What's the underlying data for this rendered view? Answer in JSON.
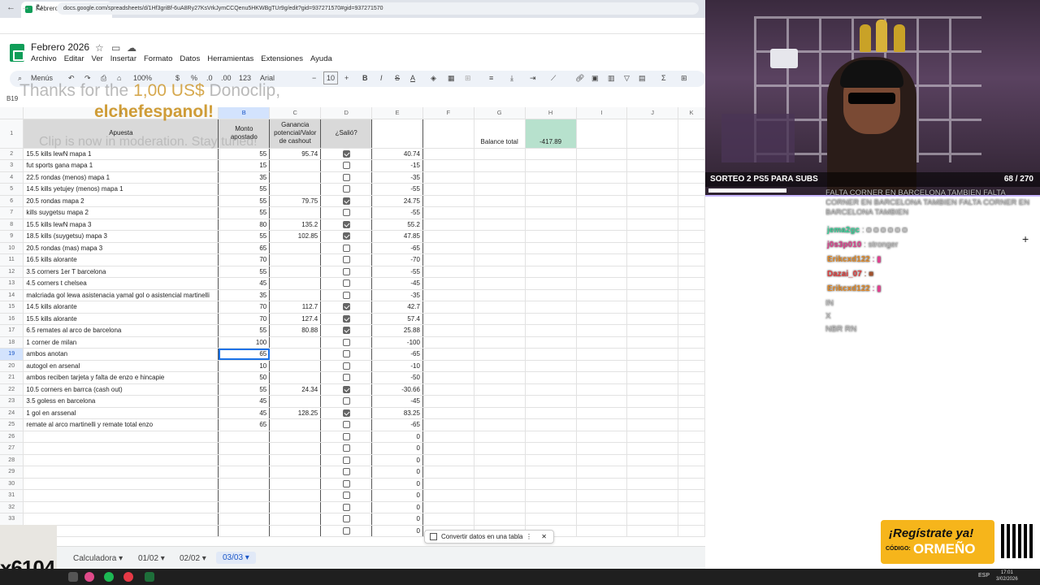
{
  "browser": {
    "tab_title": "Febrero 2026 - Hojas de cálcul",
    "tab_close": "×",
    "new_tab": "+",
    "url": "docs.google.com/spreadsheets/d/1Hf3griBf-6uA8Ry27KsVrkJymCCQenu5HKWBgTUr9g/edit?gid=937271570#gid=937271570"
  },
  "sheets": {
    "doc_title": "Febrero 2026",
    "menu": [
      "Archivo",
      "Editar",
      "Ver",
      "Insertar",
      "Formato",
      "Datos",
      "Herramientas",
      "Extensiones",
      "Ayuda"
    ],
    "toolbar": {
      "menus": "Menús",
      "zoom": "100%",
      "currency": "$",
      "percent": "%",
      "dec_less": ".0",
      "dec_more": ".00",
      "format_123": "123",
      "font": "Arial",
      "font_size": "10",
      "bold": "B",
      "italic": "I",
      "text_color": "A"
    },
    "name_box": "B19",
    "columns": [
      "A",
      "B",
      "C",
      "D",
      "E",
      "F",
      "G",
      "H",
      "I",
      "J",
      "K"
    ],
    "header_row": {
      "a": "Apuesta",
      "b": "Monto apostado",
      "c": "Ganancia potencial/Valor de cashout",
      "d": "¿Salió?",
      "g": "Balance total",
      "h": "-417.89"
    },
    "rows": [
      {
        "n": "2",
        "a": "15.5 kills lewN mapa 1",
        "b": "55",
        "c": "95.74",
        "d": true,
        "e": "40.74"
      },
      {
        "n": "3",
        "a": "fut sports gana mapa 1",
        "b": "15",
        "c": "",
        "d": false,
        "e": "-15"
      },
      {
        "n": "4",
        "a": "22.5 rondas (menos) mapa 1",
        "b": "35",
        "c": "",
        "d": false,
        "e": "-35"
      },
      {
        "n": "5",
        "a": "14.5 kills yetujey (menos) mapa 1",
        "b": "55",
        "c": "",
        "d": false,
        "e": "-55"
      },
      {
        "n": "6",
        "a": "20.5 rondas mapa 2",
        "b": "55",
        "c": "79.75",
        "d": true,
        "e": "24.75"
      },
      {
        "n": "7",
        "a": "kills suygetsu mapa 2",
        "b": "55",
        "c": "",
        "d": false,
        "e": "-55"
      },
      {
        "n": "8",
        "a": "15.5 kills lewN mapa 3",
        "b": "80",
        "c": "135.2",
        "d": true,
        "e": "55.2"
      },
      {
        "n": "9",
        "a": "18.5 kills (suygetsu) mapa 3",
        "b": "55",
        "c": "102.85",
        "d": true,
        "e": "47.85"
      },
      {
        "n": "10",
        "a": "20.5 rondas (mas) mapa 3",
        "b": "65",
        "c": "",
        "d": false,
        "e": "-65"
      },
      {
        "n": "11",
        "a": "16.5 kills alorante",
        "b": "70",
        "c": "",
        "d": false,
        "e": "-70"
      },
      {
        "n": "12",
        "a": "3.5 corners 1er T barcelona",
        "b": "55",
        "c": "",
        "d": false,
        "e": "-55"
      },
      {
        "n": "13",
        "a": "4.5 corners t chelsea",
        "b": "45",
        "c": "",
        "d": false,
        "e": "-45"
      },
      {
        "n": "14",
        "a": "malcriada gol lewa asistenacia yamal gol o asistencial martinelli",
        "b": "35",
        "c": "",
        "d": false,
        "e": "-35"
      },
      {
        "n": "15",
        "a": "14.5 kills alorante",
        "b": "70",
        "c": "112.7",
        "d": true,
        "e": "42.7"
      },
      {
        "n": "16",
        "a": "15.5 kills alorante",
        "b": "70",
        "c": "127.4",
        "d": true,
        "e": "57.4"
      },
      {
        "n": "17",
        "a": "6.5 remates al arco de barcelona",
        "b": "55",
        "c": "80.88",
        "d": true,
        "e": "25.88"
      },
      {
        "n": "18",
        "a": "1 corner de milan",
        "b": "100",
        "c": "",
        "d": false,
        "e": "-100"
      },
      {
        "n": "19",
        "a": "ambos anotan",
        "b": "65",
        "c": "",
        "d": false,
        "e": "-65"
      },
      {
        "n": "20",
        "a": "autogol en arsenal",
        "b": "10",
        "c": "",
        "d": false,
        "e": "-10"
      },
      {
        "n": "21",
        "a": "ambos reciben tarjeta y falta de enzo e hincapie",
        "b": "50",
        "c": "",
        "d": false,
        "e": "-50"
      },
      {
        "n": "22",
        "a": "10.5 corners en barrca (cash out)",
        "b": "55",
        "c": "24.34",
        "d": true,
        "e": "-30.66"
      },
      {
        "n": "23",
        "a": "3.5 goless en barcelona",
        "b": "45",
        "c": "",
        "d": false,
        "e": "-45"
      },
      {
        "n": "24",
        "a": "1 gol en arssenal",
        "b": "45",
        "c": "128.25",
        "d": true,
        "e": "83.25"
      },
      {
        "n": "25",
        "a": "remate al arco martinelli y remate total enzo",
        "b": "65",
        "c": "",
        "d": false,
        "e": "-65"
      },
      {
        "n": "26",
        "a": "",
        "b": "",
        "c": "",
        "d": false,
        "e": "0"
      },
      {
        "n": "27",
        "a": "",
        "b": "",
        "c": "",
        "d": false,
        "e": "0"
      },
      {
        "n": "28",
        "a": "",
        "b": "",
        "c": "",
        "d": false,
        "e": "0"
      },
      {
        "n": "29",
        "a": "",
        "b": "",
        "c": "",
        "d": false,
        "e": "0"
      },
      {
        "n": "30",
        "a": "",
        "b": "",
        "c": "",
        "d": false,
        "e": "0"
      },
      {
        "n": "31",
        "a": "",
        "b": "",
        "c": "",
        "d": false,
        "e": "0"
      },
      {
        "n": "32",
        "a": "",
        "b": "",
        "c": "",
        "d": false,
        "e": "0"
      },
      {
        "n": "33",
        "a": "",
        "b": "",
        "c": "",
        "d": false,
        "e": "0"
      },
      {
        "n": "34",
        "a": "",
        "b": "",
        "c": "",
        "d": false,
        "e": "0"
      }
    ],
    "convert_popup": "Convertir datos en una tabla",
    "sheet_tabs": [
      "Calculadora",
      "01/02",
      "02/02",
      "03/03"
    ],
    "active_tab": "03/03"
  },
  "overlay": {
    "dono_prefix": "Thanks for the ",
    "dono_amount": "1,00 US$",
    "dono_suffix": " Donoclip,",
    "dono_name": "elchefespanol!",
    "clip_note": "Clip is now in moderation. Stay tuned!"
  },
  "stream": {
    "caption": "SORTEO 2 PS5 PARA SUBS",
    "counter": "68 / 270",
    "chat_top": "FALTA CORNER EN BARCELONA TAMBIEN FALTA CORNER EN BARCELONA TAMBIEN FALTA CORNER EN BARCELONA TAMBIEN",
    "chat": [
      {
        "user": "jema2gc",
        "msg": ": ■ ■ ■ ■ ■ ■",
        "color": "#39d39a"
      },
      {
        "user": "j0s3p010",
        "msg": ": stronger",
        "color": "#e0408f"
      },
      {
        "user": "Erikcxd122",
        "msg": ": ▮",
        "color": "#e08a2a"
      },
      {
        "user": "Dazai_07",
        "msg": ": ■",
        "color": "#e04040"
      },
      {
        "user": "Erikcxd122",
        "msg": ": ▮",
        "color": "#e08a2a"
      }
    ],
    "chat_extra": [
      "IN",
      "X",
      "NBR RN"
    ],
    "promo_title": "¡Regístrate ya!",
    "promo_code_label": "CÓDIGO:",
    "promo_code": "ORMEÑO",
    "viewer_tag": "x6104"
  },
  "taskbar": {
    "lang": "ESP",
    "time": "17:01",
    "date": "3/02/2026"
  }
}
